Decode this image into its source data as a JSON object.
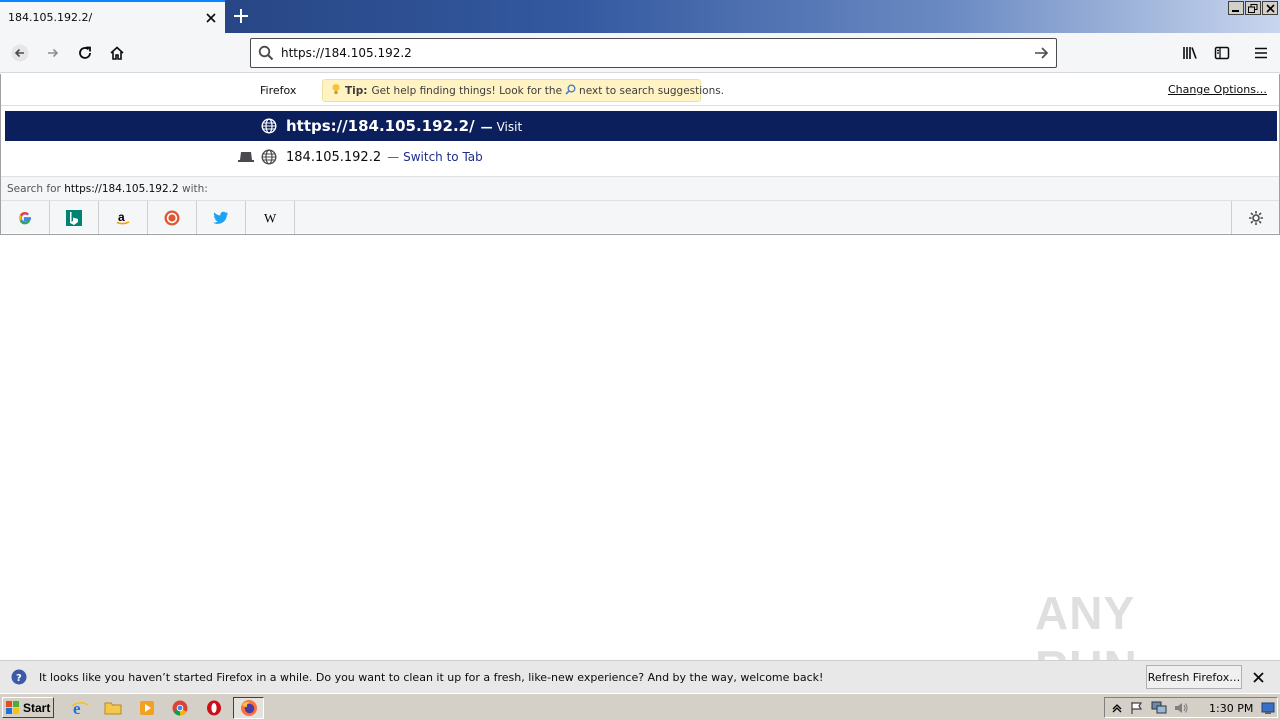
{
  "window": {
    "controls": [
      "minimize",
      "restore",
      "close"
    ]
  },
  "tabs": [
    {
      "title": "184.105.192.2/"
    }
  ],
  "navbar": {
    "url": "https://184.105.192.2",
    "icons": [
      "back-icon",
      "forward-icon",
      "reload-icon",
      "home-icon",
      "library-icon",
      "sidebar-icon",
      "menu-icon"
    ]
  },
  "dropdown": {
    "header_label": "Firefox",
    "tip_bold": "Tip:",
    "tip_before": "Get help finding things! Look for the",
    "tip_after": "next to search suggestions.",
    "change_options": "Change Options…",
    "results": [
      {
        "text": "https://184.105.192.2/",
        "sep": "—",
        "action": "Visit"
      },
      {
        "text": "184.105.192.2",
        "sep": "—",
        "action": "Switch to Tab"
      }
    ],
    "search_for_prefix": "Search for",
    "search_for_query": "https://184.105.192.2",
    "search_for_suffix": "with:",
    "engines": [
      "google",
      "bing",
      "amazon",
      "duckduckgo",
      "twitter",
      "wikipedia"
    ]
  },
  "notification": {
    "text": "It looks like you haven’t started Firefox in a while. Do you want to clean it up for a fresh, like-new experience? And by the way, welcome back!",
    "button": "Refresh Firefox…"
  },
  "watermark": "ANY RUN",
  "taskbar": {
    "start": "Start",
    "clock": "1:30 PM"
  },
  "colors": {
    "selected_row": "#0a1f5c",
    "tip_bg": "#fff3c4",
    "accent": "#0a84ff"
  }
}
